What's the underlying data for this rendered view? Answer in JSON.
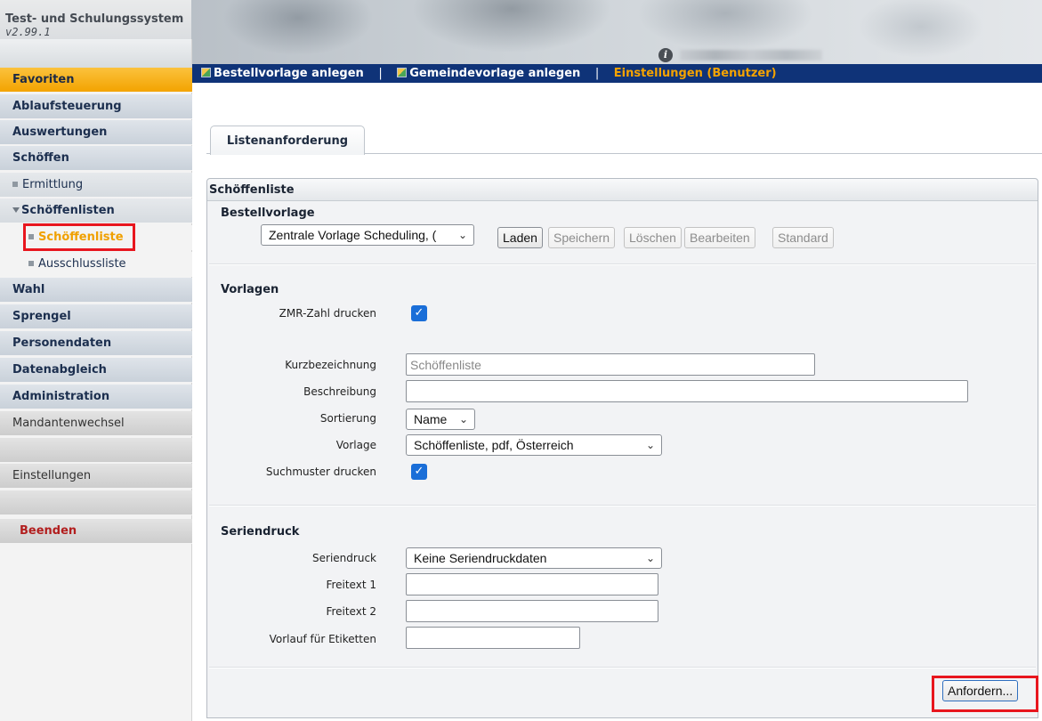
{
  "header": {
    "title": "Test- und Schulungssystem",
    "version": "v2.99.1",
    "info_icon": "info-icon"
  },
  "sidebar": {
    "items": [
      {
        "label": "Favoriten"
      },
      {
        "label": "Ablaufsteuerung"
      },
      {
        "label": "Auswertungen"
      },
      {
        "label": "Schöffen"
      },
      {
        "label": "Ermittlung"
      },
      {
        "label": "Schöffenlisten"
      },
      {
        "label": "Schöffenliste"
      },
      {
        "label": "Ausschlussliste"
      },
      {
        "label": "Wahl"
      },
      {
        "label": "Sprengel"
      },
      {
        "label": "Personendaten"
      },
      {
        "label": "Datenabgleich"
      },
      {
        "label": "Administration"
      },
      {
        "label": "Mandantenwechsel"
      },
      {
        "label": "Einstellungen"
      },
      {
        "label": "Beenden"
      }
    ]
  },
  "topnav": {
    "link1": "Bestellvorlage anlegen",
    "link2": "Gemeindevorlage anlegen",
    "link3": "Einstellungen (Benutzer)",
    "separator": "|"
  },
  "tab": {
    "label": "Listenanforderung"
  },
  "panel": {
    "title": "Schöffenliste",
    "bestellvorlage": {
      "title": "Bestellvorlage",
      "select_value": "Zentrale Vorlage Scheduling, (",
      "buttons": {
        "laden": "Laden",
        "speichern": "Speichern",
        "loeschen": "Löschen",
        "bearbeiten": "Bearbeiten",
        "standard": "Standard"
      }
    },
    "vorlagen": {
      "title": "Vorlagen",
      "zmr_label": "ZMR-Zahl drucken",
      "kurz_label": "Kurzbezeichnung",
      "kurz_placeholder": "Schöffenliste",
      "beschreibung_label": "Beschreibung",
      "sortierung_label": "Sortierung",
      "sortierung_value": "Name",
      "vorlage_label": "Vorlage",
      "vorlage_value": "Schöffenliste, pdf, Österreich",
      "suchmuster_label": "Suchmuster drucken"
    },
    "seriendruck": {
      "title": "Seriendruck",
      "seriendruck_label": "Seriendruck",
      "seriendruck_value": "Keine Seriendruckdaten",
      "freitext1_label": "Freitext 1",
      "freitext2_label": "Freitext 2",
      "vorlauf_label": "Vorlauf für Etiketten"
    },
    "submit_label": "Anfordern..."
  },
  "colors": {
    "nav_blue": "#0f3378",
    "favorite_orange": "#f3a300",
    "highlight_red": "#e8161e",
    "checkbox_blue": "#1a6ed8"
  }
}
